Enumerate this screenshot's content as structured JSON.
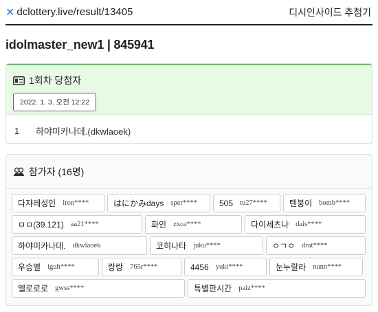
{
  "header": {
    "site": "dclottery.live/result/13405",
    "nav_link": "디시인사이드 추첨기"
  },
  "title": "idolmaster_new1 | 845941",
  "winners": {
    "heading": "1회차 당첨자",
    "date": "2022. 1. 3. 오전 12:22",
    "list": [
      {
        "num": "1",
        "name": "하야미카나데.(dkwlaoek)"
      }
    ]
  },
  "participants": {
    "heading": "참가자 (16명)",
    "rows": [
      [
        {
          "nick": "다쟈레성인",
          "id": "iron****"
        },
        {
          "nick": "はにかみdays",
          "id": "sper****"
        },
        {
          "nick": "505",
          "id": "tu27****"
        },
        {
          "nick": "텐붕이",
          "id": "bomb****"
        }
      ],
      [
        {
          "nick": "ㅁㅁ(39.121)",
          "id": "aa21****"
        },
        {
          "nick": "화인",
          "id": "zxca****"
        },
        {
          "nick": "다이세츠나",
          "id": "dais****"
        }
      ],
      [
        {
          "nick": "하야미카나데.",
          "id": "dkwlaoek"
        },
        {
          "nick": "코히나타",
          "id": "juku****"
        },
        {
          "nick": "ㅇㄱㅇ",
          "id": "drat****"
        }
      ],
      [
        {
          "nick": "우승별",
          "id": "iguh****"
        },
        {
          "nick": "랑랑",
          "id": "765r****"
        },
        {
          "nick": "4456",
          "id": "yuki****"
        },
        {
          "nick": "눈누랄라",
          "id": "nunn****"
        }
      ],
      [
        {
          "nick": "멜로로로",
          "id": "gwss****"
        },
        {
          "nick": "특별한시간",
          "id": "paiz****"
        }
      ]
    ]
  },
  "icons": {
    "brand": "x-logo-icon",
    "winner": "ticket-icon",
    "participants": "people-icon"
  },
  "colors": {
    "brand_blue": "#2f7fd6",
    "winner_bg": "#e7fbe4",
    "winner_accent": "#5fc46a"
  }
}
